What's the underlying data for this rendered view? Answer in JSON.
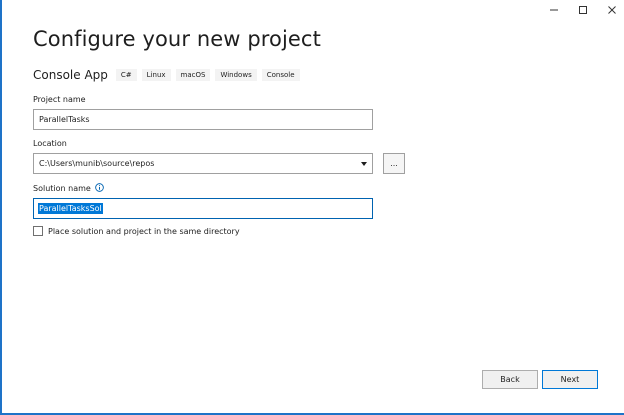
{
  "window": {
    "controls": {
      "minimize": "minimize-icon",
      "maximize": "maximize-icon",
      "close": "close-icon"
    }
  },
  "header": {
    "title": "Configure your new project",
    "template_name": "Console App",
    "tags": [
      "C#",
      "Linux",
      "macOS",
      "Windows",
      "Console"
    ]
  },
  "form": {
    "project_name": {
      "label": "Project name",
      "value": "ParallelTasks"
    },
    "location": {
      "label": "Location",
      "value": "C:\\Users\\munib\\source\\repos",
      "browse_label": "..."
    },
    "solution_name": {
      "label": "Solution name",
      "value": "ParallelTasksSol",
      "info_icon": "info-icon"
    },
    "same_directory": {
      "label": "Place solution and project in the same directory",
      "checked": false
    }
  },
  "footer": {
    "back_label": "Back",
    "next_label": "Next"
  },
  "colors": {
    "accent": "#0078d7",
    "window_border": "#1e73c8",
    "tag_background": "#f3f3f3"
  }
}
